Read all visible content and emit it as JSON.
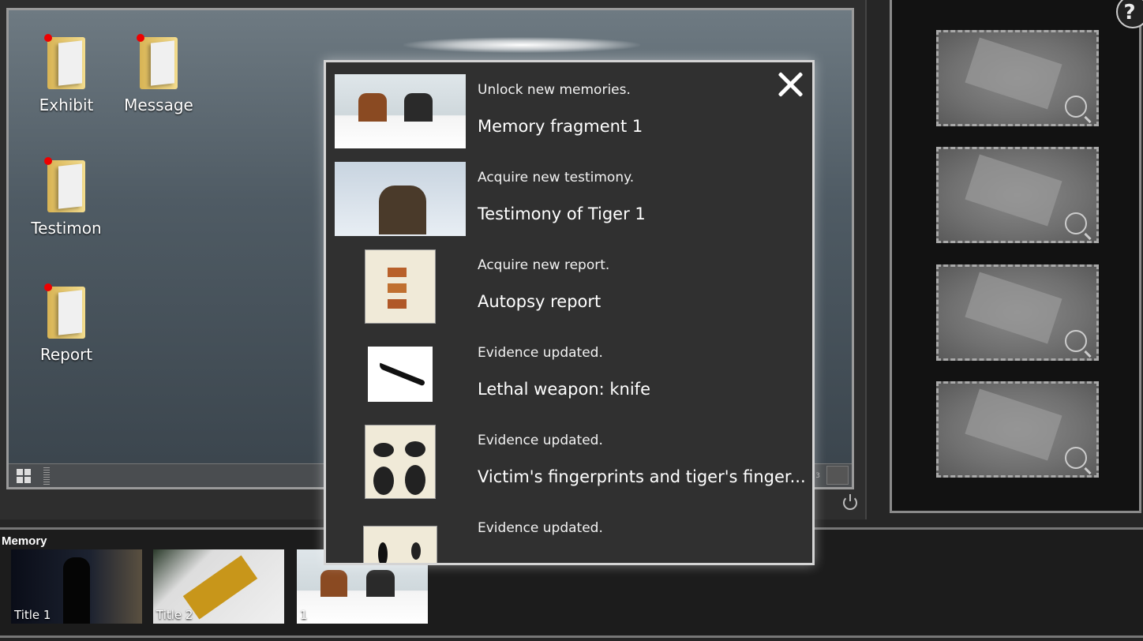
{
  "desktop": {
    "icons": [
      {
        "label": "Exhibit",
        "icon": "folder-icon",
        "new": true
      },
      {
        "label": "Message",
        "icon": "folder-icon",
        "new": true
      },
      {
        "label": "Testimon",
        "icon": "folder-icon",
        "new": true
      },
      {
        "label": "Report",
        "icon": "folder-icon",
        "new": true
      }
    ],
    "taskbar": {
      "start_icon": "windows-icon",
      "tray_text": "3"
    }
  },
  "right_panel": {
    "slots": 4,
    "slot_icon": "magnifier-icon",
    "help_label": "?"
  },
  "memory": {
    "label": "Memory",
    "items": [
      {
        "label": "Title 1"
      },
      {
        "label": "Title 2"
      },
      {
        "label": "1"
      }
    ]
  },
  "popup": {
    "close_icon": "close-icon",
    "items": [
      {
        "subtitle": "Unlock new memories.",
        "title": "Memory fragment 1"
      },
      {
        "subtitle": "Acquire new testimony.",
        "title": "Testimony of Tiger 1"
      },
      {
        "subtitle": "Acquire new report.",
        "title": "Autopsy report"
      },
      {
        "subtitle": "Evidence updated.",
        "title": "Lethal weapon: knife"
      },
      {
        "subtitle": "Evidence updated.",
        "title": "Victim's fingerprints and tiger's finger..."
      },
      {
        "subtitle": "Evidence updated.",
        "title": ""
      }
    ]
  },
  "colors": {
    "popup_bg": "#303030",
    "new_dot": "#e00000",
    "folder": "#f3dc8e"
  }
}
